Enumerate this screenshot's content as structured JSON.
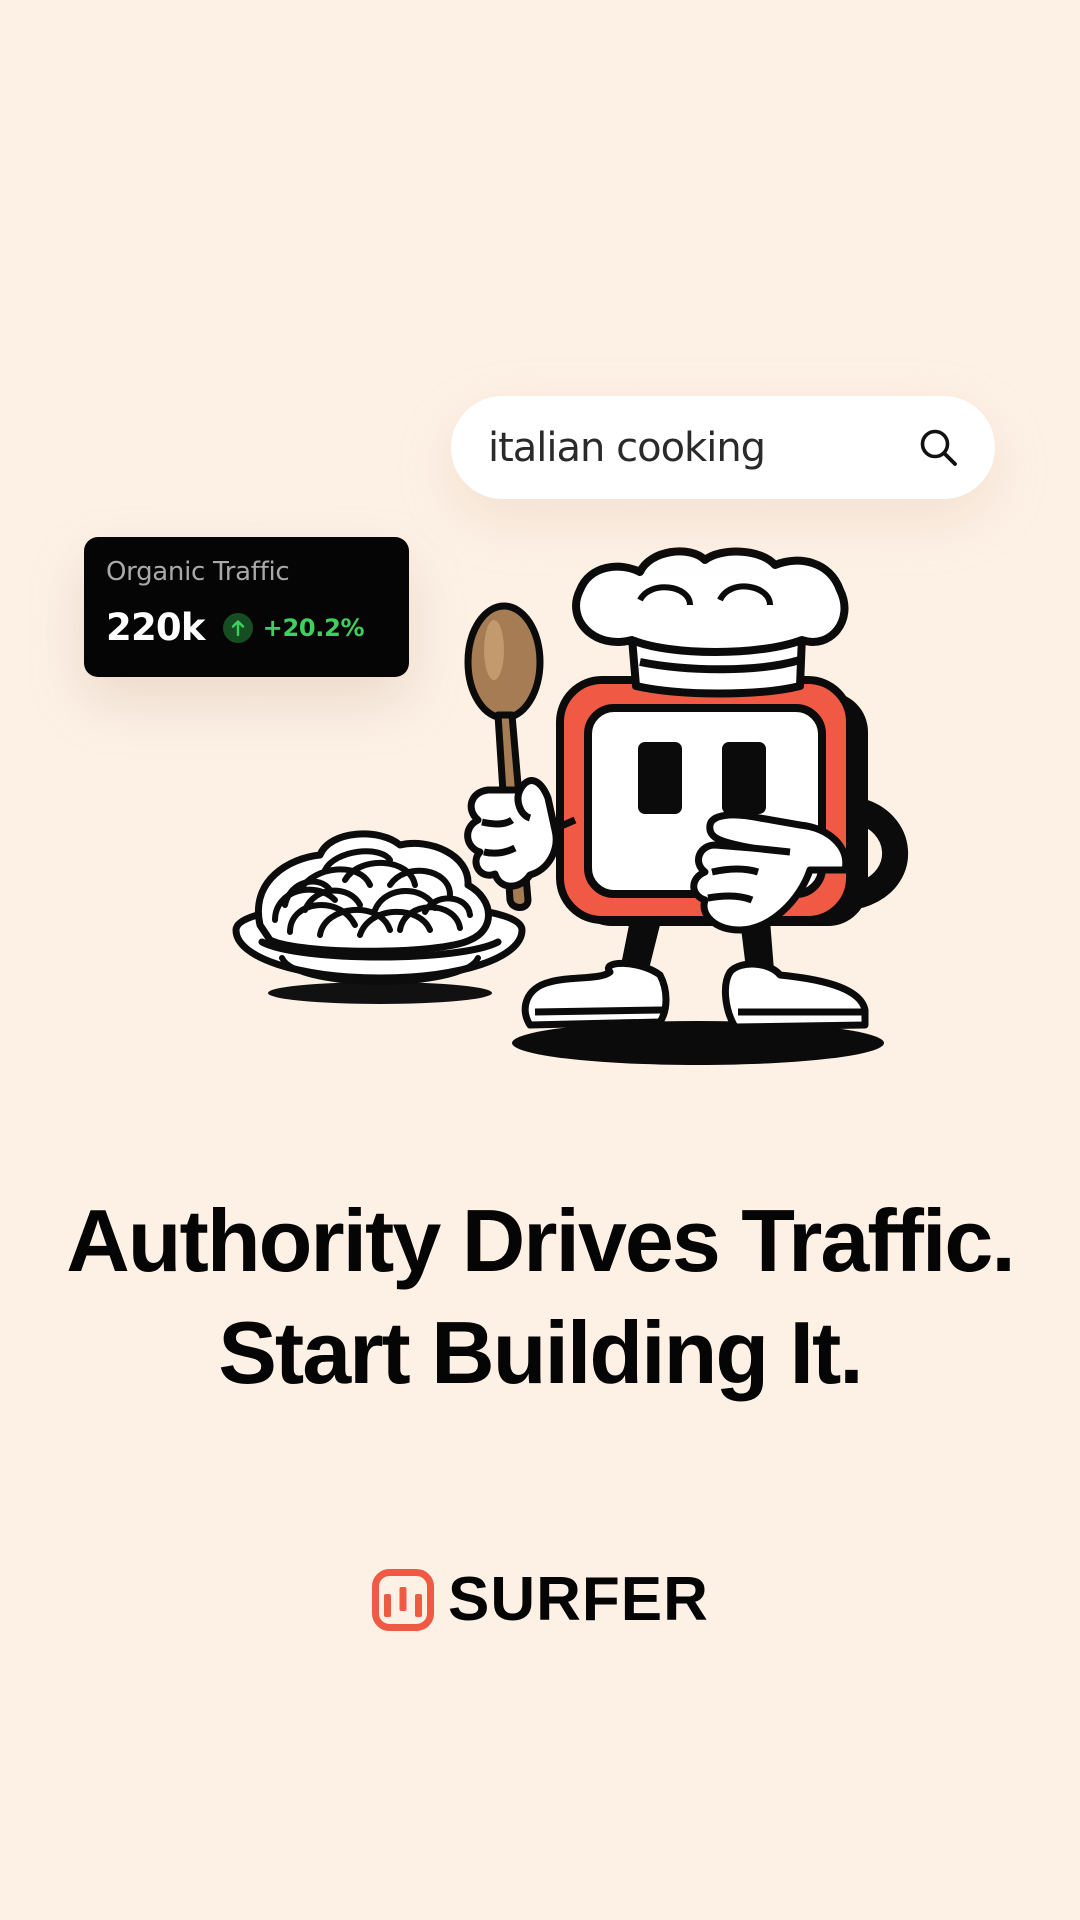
{
  "search": {
    "query": "italian cooking",
    "icon": "search-icon"
  },
  "traffic_card": {
    "label": "Organic Traffic",
    "value": "220k",
    "change": "+20.2%",
    "trend_icon": "arrow-up-icon",
    "change_color": "#3fcf5c"
  },
  "headline": {
    "line1": "Authority Drives Traffic.",
    "line2": "Start Building It."
  },
  "brand": {
    "name": "SURFER",
    "logo_icon": "surfer-logo-icon",
    "accent_color": "#f05a45"
  },
  "colors": {
    "background": "#fdf1e6",
    "mascot_frame": "#f05a45",
    "spoon": "#a57c53"
  }
}
